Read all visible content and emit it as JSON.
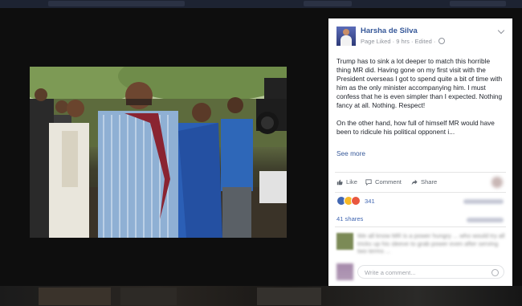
{
  "post": {
    "author": "Harsha de Silva",
    "meta": "Page Liked · 9 hrs · Edited ·",
    "paragraph_1": "Trump has to sink a lot deeper to match this horrible thing MR did. Having gone on my first visit with the President overseas I got to spend quite a bit of time with him as the only minister accompanying him. I must confess that he is even simpler than I expected. Nothing fancy at all. Nothing. Respect!",
    "paragraph_2": "On the other hand, how full of himself MR would have been to ridicule his political opponent i...",
    "see_more": "See more"
  },
  "actions": {
    "like": "Like",
    "comment": "Comment",
    "share": "Share"
  },
  "stats": {
    "reactions_count": "341",
    "shares": "41 shares"
  },
  "comment": {
    "text": "We all know MR is a power hungry ... who would try all tricks up his sleeve to grab power even after serving two terms ..."
  },
  "composer": {
    "placeholder": "Write a comment..."
  },
  "icons": [
    "globe-icon",
    "chevron-down-icon",
    "like-icon",
    "comment-icon",
    "share-icon",
    "camera-icon"
  ],
  "colors": {
    "link": "#365899",
    "reaction_like": "#4267b2",
    "reaction_haha": "#f7b928",
    "reaction_love": "#e9573f"
  }
}
